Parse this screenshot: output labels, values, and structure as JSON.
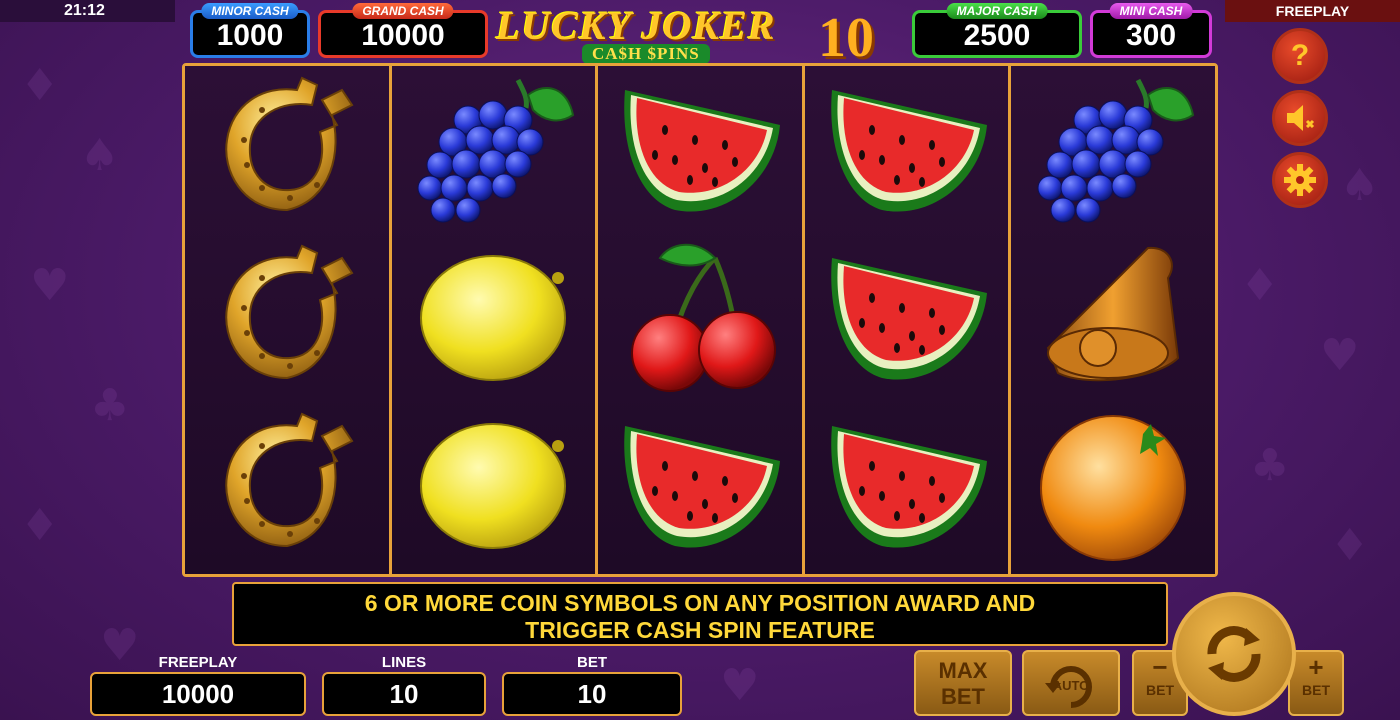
{
  "status": {
    "time": "21:12",
    "mode": "FREEPLAY"
  },
  "jackpots": {
    "minor": {
      "label": "MINOR CASH",
      "value": "1000"
    },
    "grand": {
      "label": "GRAND CASH",
      "value": "10000"
    },
    "major": {
      "label": "MAJOR CASH",
      "value": "2500"
    },
    "mini": {
      "label": "MINI CASH",
      "value": "300"
    }
  },
  "logo": {
    "title": "LUCKY JOKER",
    "number": "10",
    "subtitle": "CA$H $PINS"
  },
  "reels": [
    [
      "horseshoe-icon",
      "horseshoe-icon",
      "horseshoe-icon"
    ],
    [
      "grapes-icon",
      "lemon-icon",
      "lemon-icon"
    ],
    [
      "watermelon-icon",
      "cherries-icon",
      "watermelon-icon"
    ],
    [
      "watermelon-icon",
      "watermelon-icon",
      "watermelon-icon"
    ],
    [
      "grapes-icon",
      "bell-icon",
      "orange-icon"
    ]
  ],
  "message": {
    "line1": "6 OR MORE COIN SYMBOLS ON ANY POSITION AWARD AND",
    "line2": "TRIGGER CASH SPIN FEATURE"
  },
  "side_buttons": {
    "help": "?"
  },
  "bottom": {
    "freeplay_label": "FREEPLAY",
    "freeplay_value": "10000",
    "lines_label": "LINES",
    "lines_value": "10",
    "bet_label": "BET",
    "bet_value": "10"
  },
  "controls": {
    "maxbet_line1": "MAX",
    "maxbet_line2": "BET",
    "auto_label": "AUTO",
    "bet_minus_symbol": "−",
    "bet_minus_label": "BET",
    "bet_plus_symbol": "+",
    "bet_plus_label": "BET"
  },
  "colors": {
    "frame": "#e8a23a",
    "message_text": "#ffd83a",
    "background": "#4a1a66"
  }
}
